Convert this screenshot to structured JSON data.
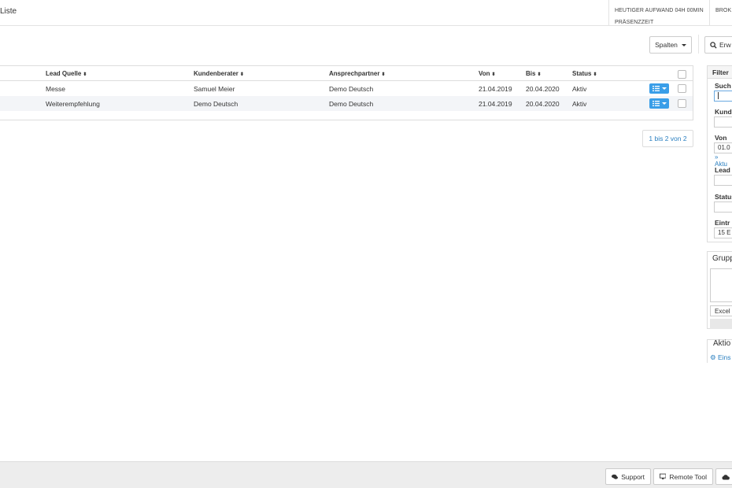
{
  "header": {
    "title": "Liste",
    "aufwand_line1": "HEUTIGER AUFWAND 04H 00MIN",
    "aufwand_line2": "PRÄSENZZEIT",
    "broker_label": "BROK"
  },
  "toolbar": {
    "spalten_label": "Spalten",
    "erweitert_label": "Erw"
  },
  "table": {
    "columns": [
      "Lead Quelle",
      "Kundenberater",
      "Ansprechpartner",
      "Von",
      "Bis",
      "Status"
    ],
    "rows": [
      {
        "lead_quelle": "Messe",
        "kundenberater": "Samuel Meier",
        "ansprechpartner": "Demo Deutsch",
        "von": "21.04.2019",
        "bis": "20.04.2020",
        "status": "Aktiv"
      },
      {
        "lead_quelle": "Weiterempfehlung",
        "kundenberater": "Demo Deutsch",
        "ansprechpartner": "Demo Deutsch",
        "von": "21.04.2019",
        "bis": "20.04.2020",
        "status": "Aktiv"
      }
    ]
  },
  "pager": {
    "label": "1 bis 2 von 2"
  },
  "filter": {
    "title": "Filter",
    "suche_label": "Such",
    "kunde_label": "Kund",
    "von_label": "Von",
    "von_value": "01.0",
    "aktuell_link": "» Aktu",
    "lead_label": "Lead",
    "status_label": "Status",
    "eintraege_label": "Eintr",
    "eintraege_value": "15 E"
  },
  "gruppe": {
    "title": "Grupp",
    "export_value": "Excel"
  },
  "aktion": {
    "title": "Aktio",
    "link": "Eins"
  },
  "footer": {
    "support_label": "Support",
    "remote_label": "Remote Tool"
  },
  "colors": {
    "accent": "#3a9ee8",
    "link": "#2a7fc0",
    "row_alt": "#f3f5f8",
    "footer_bg": "#ededed"
  }
}
